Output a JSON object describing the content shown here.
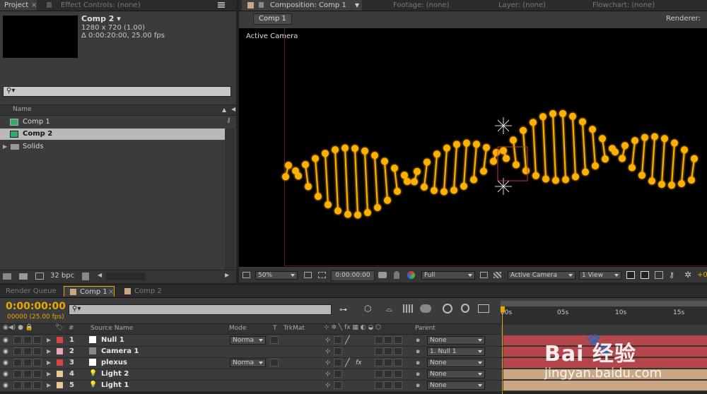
{
  "project_panel": {
    "tab_project": "Project",
    "tab_effect_controls": "Effect Controls: (none)",
    "comp_name": "Comp 2 ▾",
    "comp_size": "1280 x 720 (1.00)",
    "comp_duration": "Δ 0:00:20:00, 25.00 fps",
    "search_placeholder": "",
    "col_name": "Name",
    "items": [
      {
        "label": "Comp 1",
        "type": "comp"
      },
      {
        "label": "Comp 2",
        "type": "comp"
      },
      {
        "label": "Solids",
        "type": "folder"
      }
    ],
    "bpc": "32 bpc"
  },
  "comp_panel": {
    "tab_composition": "Composition: Comp 1",
    "tab_footage": "Footage: (none)",
    "tab_layer": "Layer: (none)",
    "tab_flowchart": "Flowchart: (none)",
    "breadcrumb": "Comp 1",
    "renderer_label": "Renderer:",
    "view_label": "Active Camera",
    "zoom": "50%",
    "timecode": "0:00:00:00",
    "resolution": "Full",
    "camera_select": "Active Camera",
    "views_select": "1 View",
    "exposure": "+0"
  },
  "timeline": {
    "tab_render_queue": "Render Queue",
    "tab_comp1": "Comp 1",
    "tab_comp2": "Comp 2",
    "current_time": "0:00:00:00",
    "frame_info": "00000 (25.00 fps)",
    "col_num": "#",
    "col_source": "Source Name",
    "col_mode": "Mode",
    "col_t": "T",
    "col_trkmat": "TrkMat",
    "col_parent": "Parent",
    "ruler": [
      "00s",
      "05s",
      "10s",
      "15s"
    ],
    "layers": [
      {
        "num": "1",
        "name": "Null 1",
        "color": "#d64545",
        "icon": "null-solid-icon",
        "mode": "Norma",
        "parent": "None",
        "bar_color": "#b5474c"
      },
      {
        "num": "2",
        "name": "Camera 1",
        "color": "#e6a8b8",
        "icon": "camera-icon",
        "mode": "",
        "parent": "1. Null 1",
        "bar_color": "#b5474c"
      },
      {
        "num": "3",
        "name": "plexus",
        "color": "#d64545",
        "icon": "solid-icon",
        "mode": "Norma",
        "parent": "None",
        "bar_color": "#b5474c"
      },
      {
        "num": "4",
        "name": "Light 2",
        "color": "#e8c79a",
        "icon": "light-icon",
        "mode": "",
        "parent": "None",
        "bar_color": "#c9a782"
      },
      {
        "num": "5",
        "name": "Light 1",
        "color": "#e8c79a",
        "icon": "light-icon",
        "mode": "",
        "parent": "None",
        "bar_color": "#c9a782"
      }
    ]
  },
  "watermark": {
    "brand": "Bai 经验",
    "url": "jingyan.baidu.com"
  },
  "colors": {
    "accent_orange": "#e8a800",
    "helix_glow": "#ffb000"
  }
}
